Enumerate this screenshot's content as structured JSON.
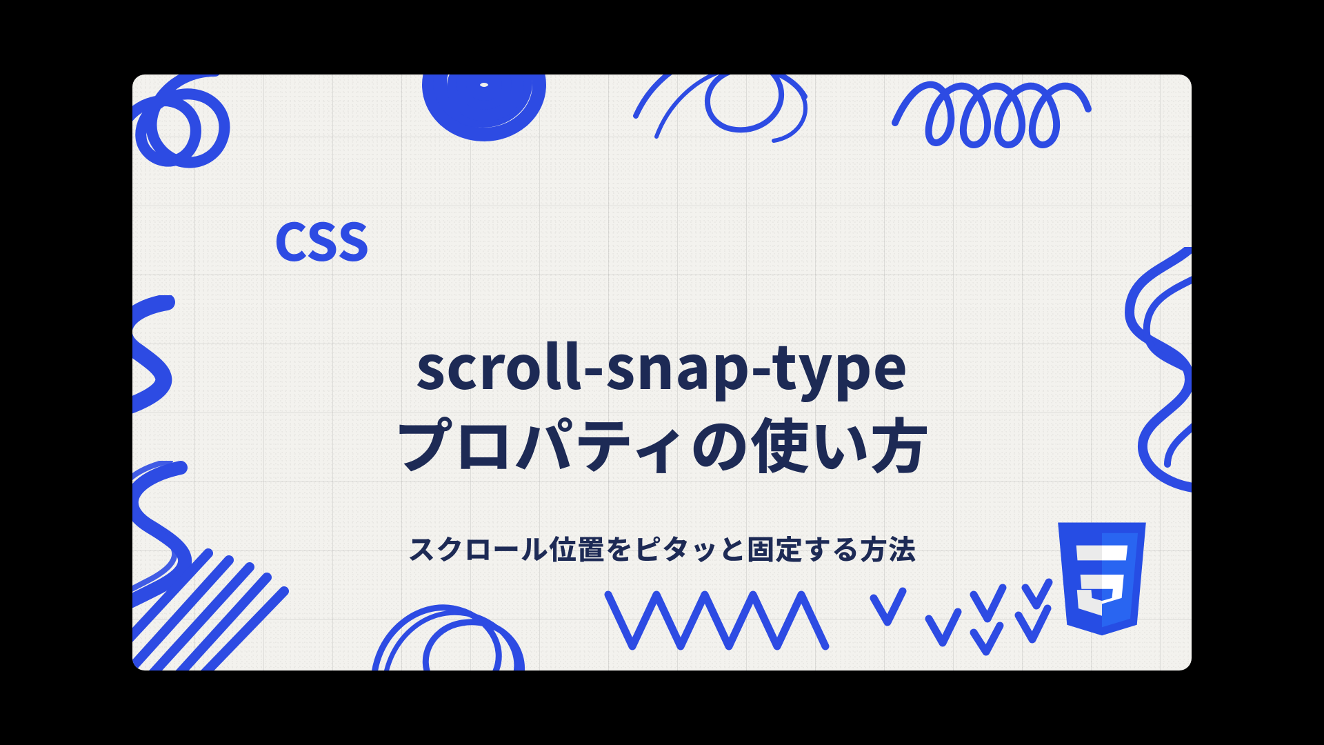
{
  "kicker": "CSS",
  "title_line1": "scroll-snap-type",
  "title_line2": "プロパティの使い方",
  "subtitle": "スクロール位置をピタッと固定する方法",
  "badge_text": "3",
  "colors": {
    "accent": "#2d4be3",
    "heading": "#1d2a55",
    "paper": "#f3f2ee"
  }
}
